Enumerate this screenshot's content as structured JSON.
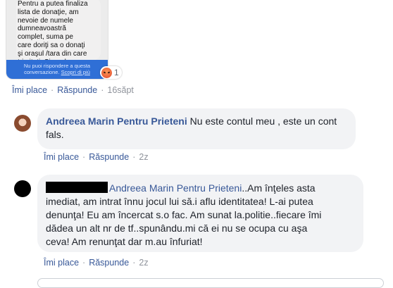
{
  "message_screenshot": {
    "body": "Pentru a putea finaliza\nlista de donaţie, am\nnevoie de numele\ndumneavoastră\ncomplet, suma pe\ncare doriţi sa o donaţi\nşi oraşul /tara din care\ntrimiteţi. Şi ora la care",
    "footer_line1": "Nu puoi rispondere a questa",
    "footer_line2_text": "conversazione.",
    "footer_link": "Scopri di più",
    "reaction_count": "1"
  },
  "post_actions": {
    "like": "Îmi place",
    "reply": "Răspunde",
    "time": "16săpt"
  },
  "comments": [
    {
      "author": "Andreea Marin Pentru Prieteni",
      "text": "Nu este contul meu , este un cont fals.",
      "like": "Îmi place",
      "reply": "Răspunde",
      "time": "2z"
    },
    {
      "author": "Andreea Marin Pentru Prieteni",
      "text": "..Am înţeles asta\nimediat, am intrat înnu jocul lui să.i aflu identitatea! L-ai putea\ndenunţa! Eu am încercat s.o fac. Am sunat la.politie..fiecare îmi\ndădea un alt nr de tf..spunându.mi că ei nu se ocupa cu aşa\nceva! Am renunţat dar m.au înfuriat!",
      "like": "Îmi place",
      "reply": "Răspunde",
      "time": "2z"
    }
  ],
  "colors": {
    "link": "#385898",
    "bubble_bg": "#f2f3f5",
    "meta": "#90949c"
  }
}
